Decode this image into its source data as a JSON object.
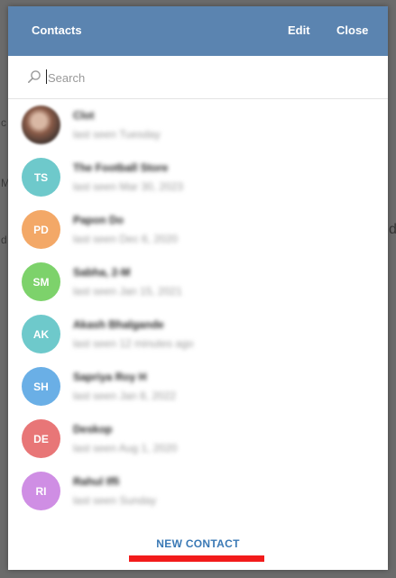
{
  "header": {
    "title": "Contacts",
    "edit_label": "Edit",
    "close_label": "Close"
  },
  "search": {
    "placeholder": "Search"
  },
  "contacts": [
    {
      "initials": "",
      "color": "",
      "name": "Clot",
      "status": "last seen Tuesday"
    },
    {
      "initials": "TS",
      "color": "#6ec9cb",
      "name": "The Football Store",
      "status": "last seen Mar 30, 2023"
    },
    {
      "initials": "PD",
      "color": "#f3a867",
      "name": "Papon Do",
      "status": "last seen Dec 6, 2020"
    },
    {
      "initials": "SM",
      "color": "#7dd26b",
      "name": "Sabha, 2-M",
      "status": "last seen Jan 15, 2021"
    },
    {
      "initials": "AK",
      "color": "#6ec9cb",
      "name": "Akash Bhalgande",
      "status": "last seen 12 minutes ago"
    },
    {
      "initials": "SH",
      "color": "#6aafe6",
      "name": "Sapriya Roy H",
      "status": "last seen Jan 8, 2022"
    },
    {
      "initials": "DE",
      "color": "#e87677",
      "name": "Deskop",
      "status": "last seen Aug 1, 2020"
    },
    {
      "initials": "RI",
      "color": "#cf8ee4",
      "name": "Rahul Iffi",
      "status": "last seen Sunday"
    }
  ],
  "footer": {
    "new_contact_label": "NEW CONTACT"
  },
  "annotation_color": "#f21b1b"
}
